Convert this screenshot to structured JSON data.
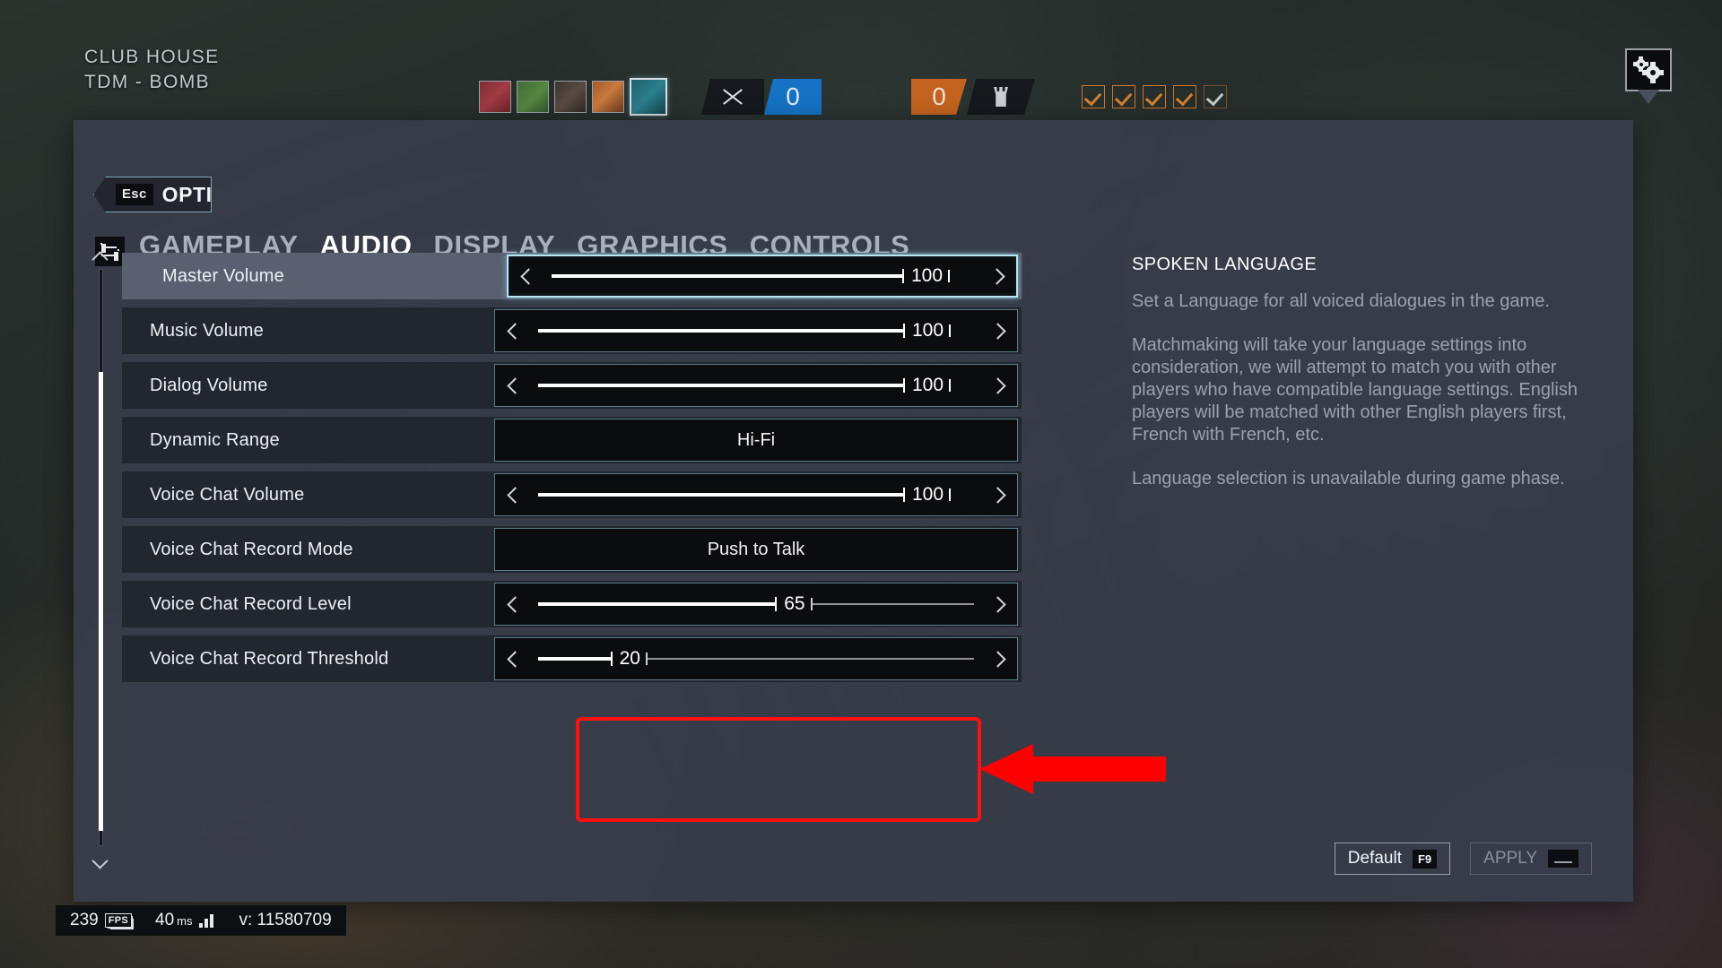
{
  "hud": {
    "map_name": "CLUB HOUSE",
    "mode": "TDM - BOMB",
    "kill_score": "0",
    "objective_score": "0",
    "operator_icons": [
      "operator-red",
      "operator-green",
      "operator-brown",
      "operator-orange",
      "operator-teal-selected"
    ],
    "checkmarks": 5,
    "settings_icon": "gear-icon"
  },
  "panel": {
    "back_key": "Esc",
    "back_label": "OPTIONS",
    "tabs": [
      {
        "label": "GAMEPLAY",
        "active": false
      },
      {
        "label": "AUDIO",
        "active": true
      },
      {
        "label": "DISPLAY",
        "active": false
      },
      {
        "label": "GRAPHICS",
        "active": false
      },
      {
        "label": "CONTROLS",
        "active": false
      }
    ]
  },
  "settings": [
    {
      "label": "Master Volume",
      "type": "slider",
      "value": 100,
      "display": "100",
      "highlight": true,
      "focus": true
    },
    {
      "label": "Music Volume",
      "type": "slider",
      "value": 100,
      "display": "100",
      "highlight": false,
      "focus": false
    },
    {
      "label": "Dialog Volume",
      "type": "slider",
      "value": 100,
      "display": "100",
      "highlight": false,
      "focus": false
    },
    {
      "label": "Dynamic Range",
      "type": "dropdown",
      "value": "Hi-Fi",
      "highlight": false,
      "focus": false
    },
    {
      "label": "Voice Chat Volume",
      "type": "slider",
      "value": 100,
      "display": "100",
      "highlight": false,
      "focus": false
    },
    {
      "label": "Voice Chat Record Mode",
      "type": "dropdown",
      "value": "Push to Talk",
      "highlight": false,
      "focus": false
    },
    {
      "label": "Voice Chat Record Level",
      "type": "slider",
      "value": 65,
      "display": "65",
      "highlight": false,
      "focus": false
    },
    {
      "label": "Voice Chat Record Threshold",
      "type": "slider",
      "value": 20,
      "display": "20",
      "highlight": false,
      "focus": false
    }
  ],
  "info": {
    "title": "SPOKEN LANGUAGE",
    "paragraphs": [
      "Set a Language for all voiced dialogues in the game.",
      "Matchmaking will take your language settings into consideration, we will attempt to match you with other players who have compatible language settings. English players will be matched with other English players first, French with French, etc.",
      "Language selection is unavailable during game phase."
    ]
  },
  "status_bar": {
    "fps_value": "239",
    "fps_label": "FPS",
    "latency_value": "40",
    "latency_unit": "ms",
    "version_label": "v: 11580709"
  },
  "footer": {
    "default_label": "Default",
    "default_key": "F9",
    "apply_label": "APPLY",
    "apply_key": "space-bar-key"
  },
  "annotation": {
    "color": "#FF0000",
    "arrow_direction": "left",
    "target": "Voice Chat Record Level and Threshold rows"
  }
}
